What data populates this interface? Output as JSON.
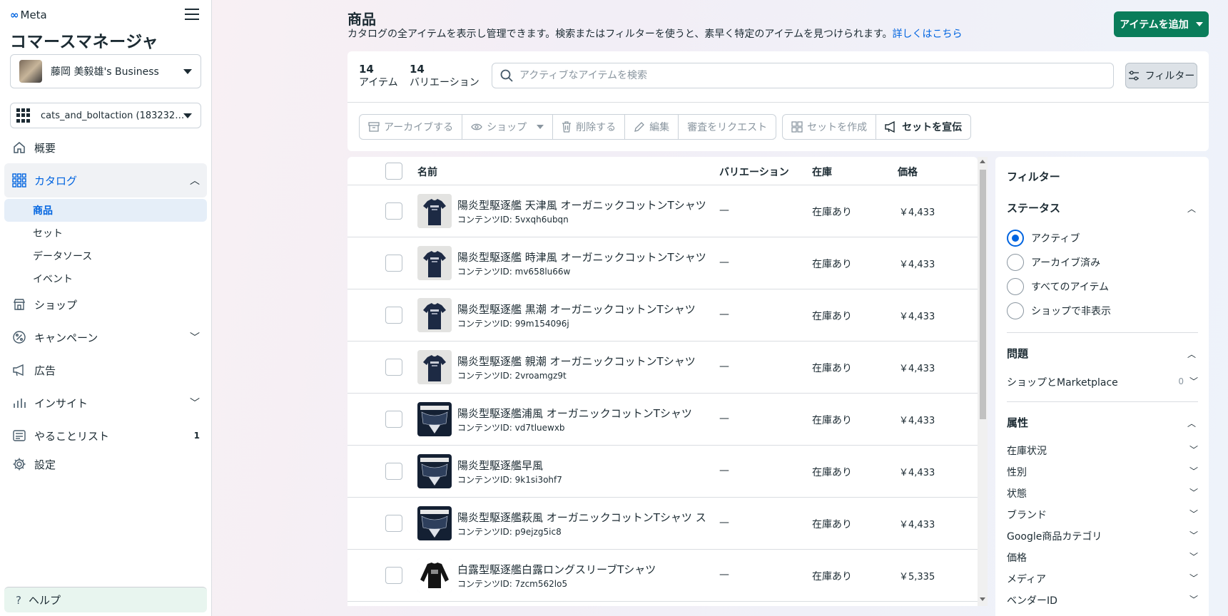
{
  "brand": {
    "meta_label": "Meta",
    "app_title": "コマースマネージャ"
  },
  "account": {
    "business_name": "藤岡 美毅雄's Business",
    "catalog_name": "cats_and_boltaction (183232…"
  },
  "nav": {
    "overview": "概要",
    "catalog": "カタログ",
    "catalog_sub": [
      "商品",
      "セット",
      "データソース",
      "イベント"
    ],
    "shop": "ショップ",
    "campaign": "キャンペーン",
    "ads": "広告",
    "insights": "インサイト",
    "todo": "やることリスト",
    "todo_count": "1",
    "settings": "設定",
    "help": "ヘルプ"
  },
  "header": {
    "title": "商品",
    "description": "カタログの全アイテムを表示し管理できます。検索またはフィルターを使うと、素早く特定のアイテムを見つけられます。",
    "learn_more": "詳しくはこちら",
    "add_button": "アイテムを追加"
  },
  "summary": {
    "items_count": "14",
    "items_label": "アイテム",
    "variations_count": "14",
    "variations_label": "バリエーション"
  },
  "search": {
    "placeholder": "アクティブなアイテムを検索",
    "value": ""
  },
  "filter_button": "フィルター",
  "toolbar": {
    "archive": "アーカイブする",
    "shop": "ショップ",
    "delete": "削除する",
    "edit": "編集",
    "request_review": "審査をリクエスト",
    "create_set": "セットを作成",
    "promote_set": "セットを宣伝"
  },
  "table": {
    "columns": [
      "名前",
      "バリエーション",
      "在庫",
      "価格"
    ],
    "rows": [
      {
        "name": "陽炎型駆逐艦 天津風 オーガニックコットンTシャツ",
        "content_id": "コンテンツID: 5vxqh6ubqn",
        "variation": "—",
        "stock": "在庫あり",
        "price": "￥4,433",
        "thumb": "navy-tshirt"
      },
      {
        "name": "陽炎型駆逐艦 時津風 オーガニックコットンTシャツ",
        "content_id": "コンテンツID: mv658lu66w",
        "variation": "—",
        "stock": "在庫あり",
        "price": "￥4,433",
        "thumb": "navy-tshirt"
      },
      {
        "name": "陽炎型駆逐艦 黒潮 オーガニックコットンTシャツ",
        "content_id": "コンテンツID: 99m154096j",
        "variation": "—",
        "stock": "在庫あり",
        "price": "￥4,433",
        "thumb": "navy-tshirt"
      },
      {
        "name": "陽炎型駆逐艦 親潮 オーガニックコットンTシャツ",
        "content_id": "コンテンツID: 2vroamgz9t",
        "variation": "—",
        "stock": "在庫あり",
        "price": "￥4,433",
        "thumb": "navy-tshirt"
      },
      {
        "name": "陽炎型駆逐艦浦風 オーガニックコットンTシャツ",
        "content_id": "コンテンツID: vd7tluewxb",
        "variation": "—",
        "stock": "在庫あり",
        "price": "￥4,433",
        "thumb": "dark-print"
      },
      {
        "name": "陽炎型駆逐艦早風",
        "content_id": "コンテンツID: 9k1si3ohf7",
        "variation": "—",
        "stock": "在庫あり",
        "price": "￥4,433",
        "thumb": "dark-print"
      },
      {
        "name": "陽炎型駆逐艦萩風 オーガニックコットンTシャツ スタ…",
        "content_id": "コンテンツID: p9ejzg5ic8",
        "variation": "—",
        "stock": "在庫あり",
        "price": "￥4,433",
        "thumb": "dark-print"
      },
      {
        "name": "白露型駆逐艦白露ロングスリーブTシャツ",
        "content_id": "コンテンツID: 7zcm562lo5",
        "variation": "—",
        "stock": "在庫あり",
        "price": "￥5,335",
        "thumb": "black-longsleeve"
      }
    ]
  },
  "filters": {
    "title": "フィルター",
    "status_title": "ステータス",
    "status_options": [
      "アクティブ",
      "アーカイブ済み",
      "すべてのアイテム",
      "ショップで非表示"
    ],
    "status_selected": "アクティブ",
    "issues_title": "問題",
    "issues_row": "ショップとMarketplace",
    "issues_count": "0",
    "attributes_title": "属性",
    "attributes": [
      "在庫状況",
      "性別",
      "状態",
      "ブランド",
      "Google商品カテゴリ",
      "価格",
      "メディア",
      "ベンダーID"
    ]
  },
  "colors": {
    "accent": "#0064e0",
    "add_button": "#0a7d5a"
  }
}
